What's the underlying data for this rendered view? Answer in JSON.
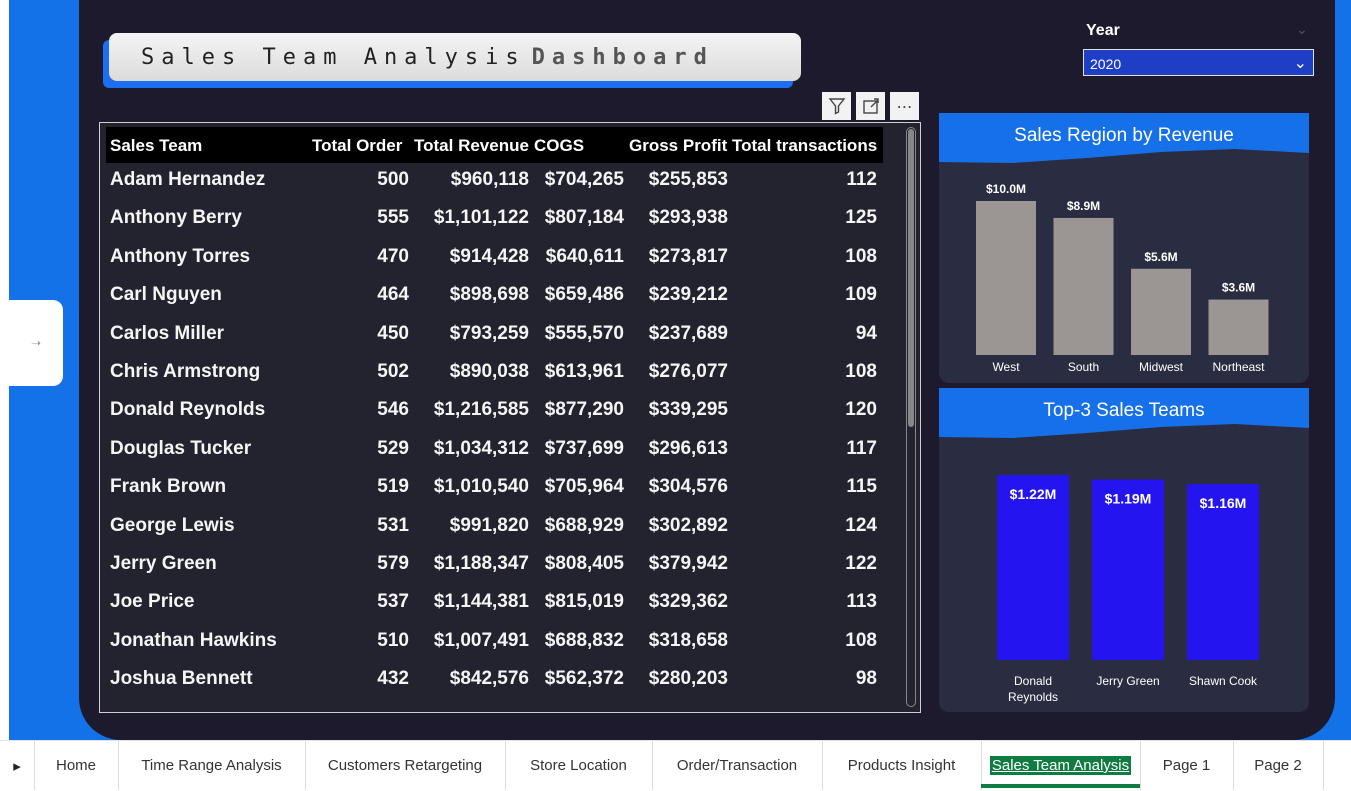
{
  "report": {
    "title_light": "Sales Team Analysis",
    "title_bold": "Dashboard"
  },
  "visual_actions": {
    "filter_icon": "filter-icon",
    "focus_icon": "focus-mode-icon",
    "more_label": "⋯"
  },
  "table": {
    "columns": [
      "Sales Team",
      "Total Order",
      "Total Revenue",
      "COGS",
      "Gross Profit",
      "Total transactions"
    ],
    "rows": [
      [
        "Adam Hernandez",
        "500",
        "$960,118",
        "$704,265",
        "$255,853",
        "112"
      ],
      [
        "Anthony Berry",
        "555",
        "$1,101,122",
        "$807,184",
        "$293,938",
        "125"
      ],
      [
        "Anthony Torres",
        "470",
        "$914,428",
        "$640,611",
        "$273,817",
        "108"
      ],
      [
        "Carl Nguyen",
        "464",
        "$898,698",
        "$659,486",
        "$239,212",
        "109"
      ],
      [
        "Carlos Miller",
        "450",
        "$793,259",
        "$555,570",
        "$237,689",
        "94"
      ],
      [
        "Chris Armstrong",
        "502",
        "$890,038",
        "$613,961",
        "$276,077",
        "108"
      ],
      [
        "Donald Reynolds",
        "546",
        "$1,216,585",
        "$877,290",
        "$339,295",
        "120"
      ],
      [
        "Douglas Tucker",
        "529",
        "$1,034,312",
        "$737,699",
        "$296,613",
        "117"
      ],
      [
        "Frank Brown",
        "519",
        "$1,010,540",
        "$705,964",
        "$304,576",
        "115"
      ],
      [
        "George Lewis",
        "531",
        "$991,820",
        "$688,929",
        "$302,892",
        "124"
      ],
      [
        "Jerry Green",
        "579",
        "$1,188,347",
        "$808,405",
        "$379,942",
        "122"
      ],
      [
        "Joe Price",
        "537",
        "$1,144,381",
        "$815,019",
        "$329,362",
        "113"
      ],
      [
        "Jonathan Hawkins",
        "510",
        "$1,007,491",
        "$688,832",
        "$318,658",
        "108"
      ],
      [
        "Joshua Bennett",
        "432",
        "$842,576",
        "$562,372",
        "$280,203",
        "98"
      ]
    ]
  },
  "slicer": {
    "label": "Year",
    "selected": "2020",
    "collapse_icon": "chevron-down-icon"
  },
  "chart_data": [
    {
      "type": "bar",
      "title": "Sales Region by Revenue",
      "categories": [
        "West",
        "South",
        "Midwest",
        "Northeast"
      ],
      "values": [
        10.0,
        8.9,
        5.6,
        3.6
      ],
      "data_labels": [
        "$10.0M",
        "$8.9M",
        "$5.6M",
        "$3.6M"
      ],
      "bar_color": "#9b9693",
      "grid": false
    },
    {
      "type": "bar",
      "title": "Top-3 Sales Teams",
      "categories": [
        "Donald Reynolds",
        "Jerry Green",
        "Shawn Cook"
      ],
      "values": [
        1.22,
        1.19,
        1.16
      ],
      "data_labels": [
        "$1.22M",
        "$1.19M",
        "$1.16M"
      ],
      "bar_color": "#2415f0",
      "grid": false
    }
  ],
  "tabs": {
    "nav_icon": "▸",
    "items": [
      "Home",
      "Time Range Analysis",
      "Customers Retargeting",
      "Store Location",
      "Order/Transaction",
      "Products Insight",
      "Sales Team Analysis",
      "Page 1",
      "Page 2"
    ],
    "active": "Sales Team Analysis"
  },
  "colors": {
    "canvas": "#1372e8",
    "panel": "#1e1a2e",
    "accent": "#1670ea",
    "active_tab": "#107c41"
  }
}
